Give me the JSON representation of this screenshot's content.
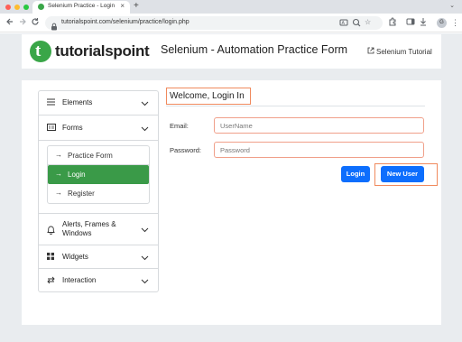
{
  "browser": {
    "tab_title": "Selenium Practice - Login",
    "tab_close": "×",
    "new_tab": "+",
    "tab_list": "⌄",
    "url": "tutorialspoint.com/selenium/practice/login.php",
    "avatar": "G",
    "icons": [
      "back-icon",
      "forward-icon",
      "reload-icon",
      "lock-icon",
      "translate-icon",
      "zoom-icon",
      "bookmark-star-icon",
      "extensions-icon",
      "sidebar-icon",
      "profile-icon",
      "menu-icon"
    ]
  },
  "header": {
    "logo_text": "tutorialspoint",
    "logo_letter": "t",
    "title": "Selenium - Automation Practice Form",
    "link_label": "Selenium Tutorial"
  },
  "sidebar": {
    "items": [
      {
        "label": "Elements",
        "icon": "hamburger-icon"
      },
      {
        "label": "Forms",
        "icon": "form-icon"
      },
      {
        "label": "Alerts, Frames & Windows",
        "icon": "bell-icon"
      },
      {
        "label": "Widgets",
        "icon": "grid-icon"
      },
      {
        "label": "Interaction",
        "icon": "arrows-icon"
      }
    ],
    "sub_items": [
      {
        "label": "Practice Form",
        "active": false
      },
      {
        "label": "Login",
        "active": true
      },
      {
        "label": "Register",
        "active": false
      }
    ]
  },
  "form": {
    "heading": "Welcome, Login In",
    "email_label": "Email:",
    "email_placeholder": "UserName",
    "password_label": "Password:",
    "password_placeholder": "Password",
    "login_button": "Login",
    "new_user_button": "New User"
  },
  "colors": {
    "brand_green": "#3aa648",
    "active_green": "#3a9a48",
    "primary_blue": "#0d6efd",
    "highlight_orange": "#f08a5d"
  }
}
